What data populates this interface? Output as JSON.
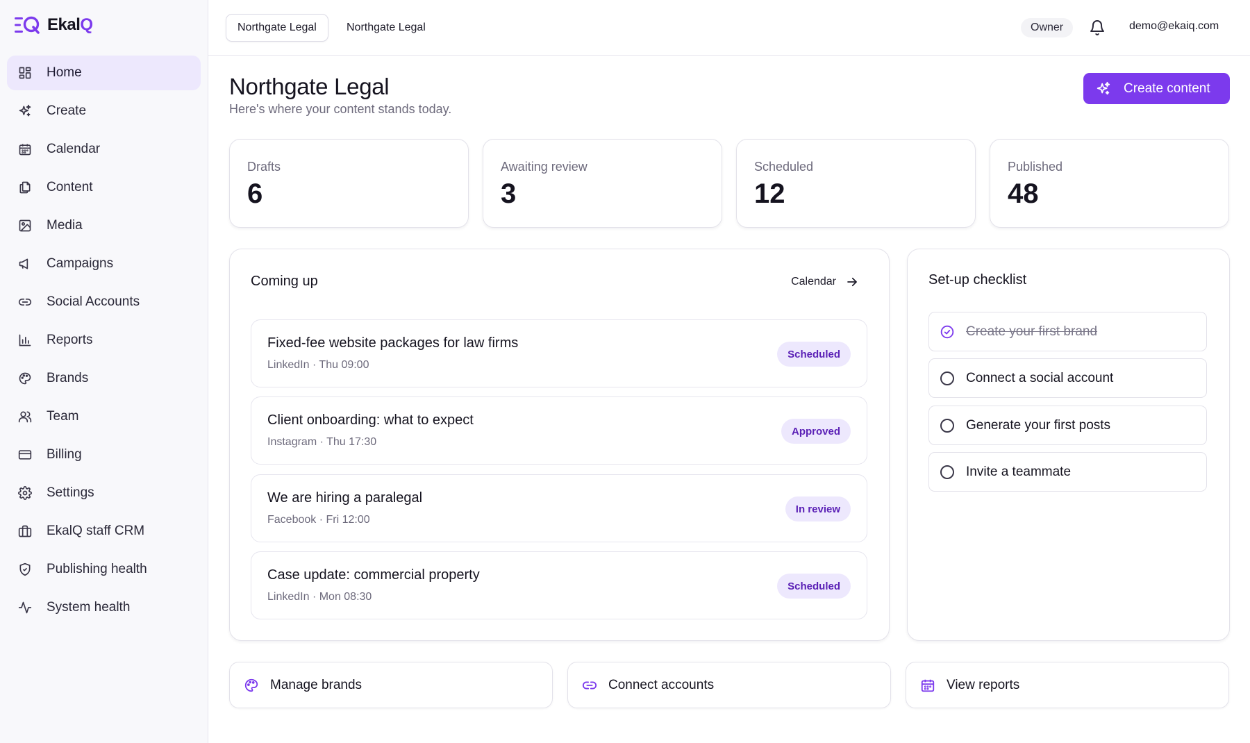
{
  "app": {
    "logo_prefix": "Ekal",
    "logo_accent": "Q",
    "accent_color": "#7c3aed"
  },
  "sidebar": {
    "items": [
      {
        "label": "Home",
        "icon": "grid-icon",
        "active": true
      },
      {
        "label": "Create",
        "icon": "sparkle-icon"
      },
      {
        "label": "Calendar",
        "icon": "calendar-icon"
      },
      {
        "label": "Content",
        "icon": "documents-icon"
      },
      {
        "label": "Media",
        "icon": "image-icon"
      },
      {
        "label": "Campaigns",
        "icon": "megaphone-icon"
      },
      {
        "label": "Social Accounts",
        "icon": "link-icon"
      },
      {
        "label": "Reports",
        "icon": "bar-chart-icon"
      },
      {
        "label": "Brands",
        "icon": "palette-icon"
      },
      {
        "label": "Team",
        "icon": "users-icon"
      },
      {
        "label": "Billing",
        "icon": "credit-card-icon"
      },
      {
        "label": "Settings",
        "icon": "gear-icon"
      },
      {
        "label": "EkalQ staff CRM",
        "icon": "briefcase-icon"
      },
      {
        "label": "Publishing health",
        "icon": "shield-icon"
      },
      {
        "label": "System health",
        "icon": "activity-icon"
      }
    ]
  },
  "header": {
    "workspace_tabs": [
      "Northgate Legal",
      "Northgate Legal"
    ],
    "role": "Owner",
    "user_email": "demo@ekaiq.com"
  },
  "main": {
    "title": "Northgate Legal",
    "subtitle": "Here's where your content stands today.",
    "create_button": "Create content",
    "stats": [
      {
        "label": "Drafts",
        "value": "6"
      },
      {
        "label": "Awaiting review",
        "value": "3"
      },
      {
        "label": "Scheduled",
        "value": "12"
      },
      {
        "label": "Published",
        "value": "48"
      }
    ],
    "coming_up": {
      "title": "Coming up",
      "link": "Calendar",
      "events": [
        {
          "title": "Fixed-fee website packages for law firms",
          "meta": "LinkedIn · Thu 09:00",
          "status": "Scheduled"
        },
        {
          "title": "Client onboarding: what to expect",
          "meta": "Instagram · Thu 17:30",
          "status": "Approved"
        },
        {
          "title": "We are hiring a paralegal",
          "meta": "Facebook · Fri 12:00",
          "status": "In review"
        },
        {
          "title": "Case update: commercial property",
          "meta": "LinkedIn · Mon 08:30",
          "status": "Scheduled"
        }
      ]
    },
    "checklist": {
      "title": "Set-up checklist",
      "items": [
        {
          "label": "Create your first brand",
          "done": true
        },
        {
          "label": "Connect a social account",
          "done": false
        },
        {
          "label": "Generate your first posts",
          "done": false
        },
        {
          "label": "Invite a teammate",
          "done": false
        }
      ]
    },
    "quick_actions": [
      {
        "label": "Manage brands",
        "icon": "palette-icon"
      },
      {
        "label": "Connect accounts",
        "icon": "link-icon"
      },
      {
        "label": "View reports",
        "icon": "calendar-icon"
      }
    ]
  }
}
